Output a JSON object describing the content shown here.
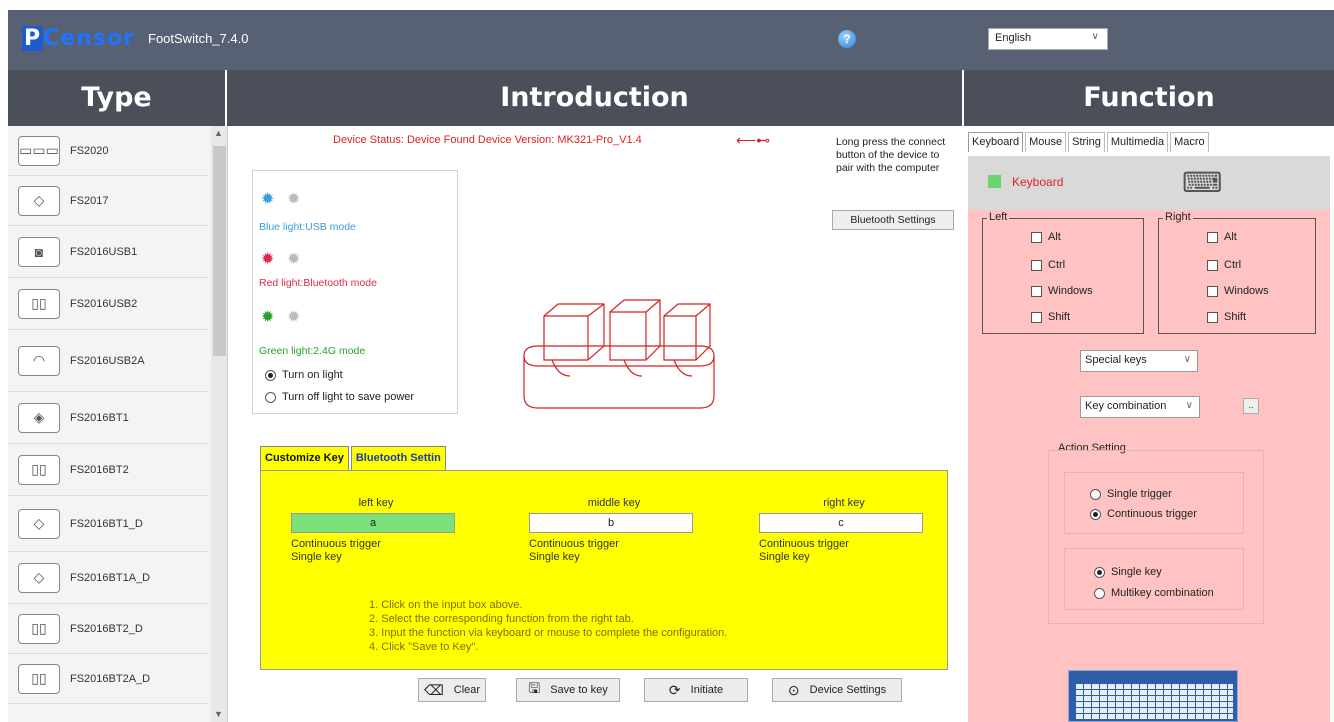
{
  "app": {
    "logo_p": "P",
    "logo_rest": "Censor",
    "title": "FootSwitch_7.4.0",
    "help_icon": "help-icon",
    "language": "English"
  },
  "headers": {
    "type": "Type",
    "intro": "Introduction",
    "function": "Function"
  },
  "types": [
    {
      "label": "FS2020",
      "icon": "triple-pedal-icon"
    },
    {
      "label": "FS2017",
      "icon": "pedal-icon"
    },
    {
      "label": "FS2016USB1",
      "icon": "single-pedal-icon"
    },
    {
      "label": "FS2016USB2",
      "icon": "double-pedal-icon"
    },
    {
      "label": "FS2016USB2A",
      "icon": "pedal-icon"
    },
    {
      "label": "FS2016BT1",
      "icon": "pedal-icon"
    },
    {
      "label": "FS2016BT2",
      "icon": "double-pedal-icon"
    },
    {
      "label": "FS2016BT1_D",
      "icon": "pedal-icon"
    },
    {
      "label": "FS2016BT1A_D",
      "icon": "pedal-icon"
    },
    {
      "label": "FS2016BT2_D",
      "icon": "double-pedal-icon"
    },
    {
      "label": "FS2016BT2A_D",
      "icon": "double-pedal-icon"
    }
  ],
  "intro": {
    "status": "Device Status:  Device Found      Device Version:   MK321-Pro_V1.4",
    "pair_text": "Long press the connect button of the device to pair with the computer",
    "bt_settings_button": "Bluetooth Settings",
    "lights": {
      "blue": "Blue light:USB mode",
      "red": "Red light:Bluetooth mode",
      "green": "Green light:2.4G mode",
      "on": "Turn on light",
      "off": "Turn off light to save power"
    },
    "colors": {
      "blue": "#3a9ee0",
      "red": "#e0284a",
      "green": "#2aa02a"
    }
  },
  "tabs": {
    "customize": "Customize Key",
    "bluetooth": "Bluetooth Settin"
  },
  "keys": [
    {
      "title": "left key",
      "value": "a",
      "trigger": "Continuous trigger",
      "mode": "Single key"
    },
    {
      "title": "middle key",
      "value": "b",
      "trigger": "Continuous trigger",
      "mode": "Single key"
    },
    {
      "title": "right key",
      "value": "c",
      "trigger": "Continuous trigger",
      "mode": "Single key"
    }
  ],
  "instructions": [
    "1. Click on the input box above.",
    "2. Select the corresponding function from the right tab.",
    "3. Input the function via keyboard or mouse to complete the configuration.",
    "4. Click \"Save to Key\"."
  ],
  "buttons": {
    "clear": "Clear",
    "save": "Save to key",
    "initiate": "Initiate",
    "device_settings": "Device Settings"
  },
  "function": {
    "tabs": [
      "Keyboard",
      "Mouse",
      "String",
      "Multimedia",
      "Macro"
    ],
    "keyboard_label": "Keyboard",
    "left_title": "Left",
    "right_title": "Right",
    "modifiers": [
      "Alt",
      "Ctrl",
      "Windows",
      "Shift"
    ],
    "special_keys": "Special keys",
    "key_combination": "Key combination",
    "dots": "..",
    "action_setting": "Action Setting",
    "single_trigger": "Single trigger",
    "continuous_trigger": "Continuous trigger",
    "single_key": "Single key",
    "multikey": "Multikey  combination"
  }
}
